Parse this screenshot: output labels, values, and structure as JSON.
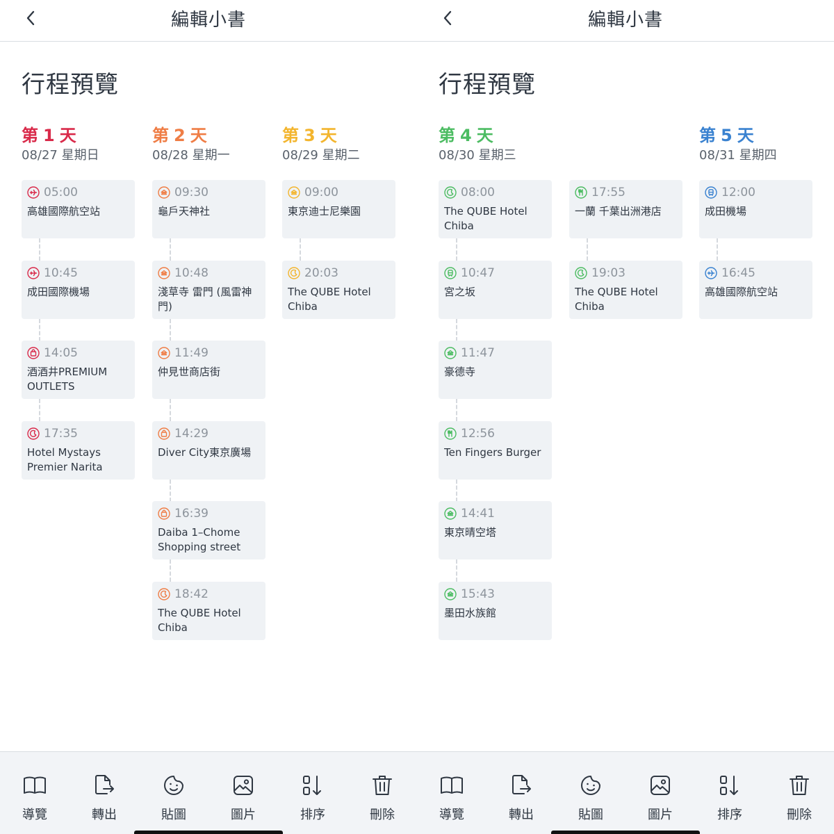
{
  "colors": {
    "text": "#2f3742",
    "muted": "#8d949c",
    "card_bg": "#eff2f5",
    "toolbar_bg": "#f2f4f7",
    "day1": "#d92a4a",
    "day2": "#ef7d45",
    "day3": "#f3b52e",
    "day4": "#4cbc62",
    "day5": "#3a82d0"
  },
  "screens": [
    {
      "header": {
        "title": "編輯小書"
      },
      "page_title": "行程預覽",
      "toolbar": [
        {
          "label": "導覽",
          "icon": "book-icon"
        },
        {
          "label": "轉出",
          "icon": "file-export-icon"
        },
        {
          "label": "貼圖",
          "icon": "sticker-icon"
        },
        {
          "label": "圖片",
          "icon": "image-icon"
        },
        {
          "label": "排序",
          "icon": "sort-icon"
        },
        {
          "label": "刪除",
          "icon": "trash-icon"
        }
      ]
    },
    {
      "header": {
        "title": "編輯小書"
      },
      "page_title": "行程預覽",
      "toolbar": [
        {
          "label": "導覽",
          "icon": "book-icon"
        },
        {
          "label": "轉出",
          "icon": "file-export-icon"
        },
        {
          "label": "貼圖",
          "icon": "sticker-icon"
        },
        {
          "label": "圖片",
          "icon": "image-icon"
        },
        {
          "label": "排序",
          "icon": "sort-icon"
        },
        {
          "label": "刪除",
          "icon": "trash-icon"
        }
      ]
    }
  ],
  "days": [
    {
      "prefix": "第",
      "number": "1",
      "suffix": "天",
      "date": "08/27 星期日",
      "color": "#d92a4a",
      "items": [
        {
          "time": "05:00",
          "name": "高雄國際航空站",
          "icon": "plane-icon"
        },
        {
          "time": "10:45",
          "name": "成田國際機場",
          "icon": "plane-icon"
        },
        {
          "time": "14:05",
          "name": "酒酒井PREMIUM OUTLETS",
          "icon": "shopping-bag-icon"
        },
        {
          "time": "17:35",
          "name": "Hotel Mystays Premier Narita",
          "icon": "moon-icon"
        }
      ]
    },
    {
      "prefix": "第",
      "number": "2",
      "suffix": "天",
      "date": "08/28 星期一",
      "color": "#ef7d45",
      "items": [
        {
          "time": "09:30",
          "name": "龜戶天神社",
          "icon": "attraction-icon"
        },
        {
          "time": "10:48",
          "name": "淺草寺 雷門 (風雷神門)",
          "icon": "attraction-icon"
        },
        {
          "time": "11:49",
          "name": "仲見世商店街",
          "icon": "attraction-icon"
        },
        {
          "time": "14:29",
          "name": "Diver City東京廣場",
          "icon": "shopping-bag-icon"
        },
        {
          "time": "16:39",
          "name": "Daiba 1–Chome Shopping street",
          "icon": "shopping-bag-icon"
        },
        {
          "time": "18:42",
          "name": "The QUBE Hotel Chiba",
          "icon": "moon-icon"
        }
      ]
    },
    {
      "prefix": "第",
      "number": "3",
      "suffix": "天",
      "date": "08/29 星期二",
      "color": "#f3b52e",
      "items": [
        {
          "time": "09:00",
          "name": "東京迪士尼樂園",
          "icon": "attraction-icon"
        },
        {
          "time": "20:03",
          "name": "The QUBE Hotel Chiba",
          "icon": "moon-icon"
        }
      ]
    },
    {
      "prefix": "第",
      "number": "4",
      "suffix": "天",
      "date": "08/30 星期三",
      "color": "#4cbc62",
      "items": [
        {
          "time": "08:00",
          "name": "The QUBE Hotel Chiba",
          "icon": "moon-icon"
        },
        {
          "time": "10:47",
          "name": "宮之坂",
          "icon": "train-icon"
        },
        {
          "time": "11:47",
          "name": "豪德寺",
          "icon": "attraction-icon"
        },
        {
          "time": "12:56",
          "name": "Ten Fingers Burger",
          "icon": "restaurant-icon"
        },
        {
          "time": "14:41",
          "name": "東京晴空塔",
          "icon": "attraction-icon"
        },
        {
          "time": "15:43",
          "name": "墨田水族館",
          "icon": "attraction-icon"
        }
      ],
      "items_b": [
        {
          "time": "17:55",
          "name": "一蘭 千葉出洲港店",
          "icon": "restaurant-icon"
        },
        {
          "time": "19:03",
          "name": "The QUBE Hotel Chiba",
          "icon": "moon-icon"
        }
      ]
    },
    {
      "prefix": "第",
      "number": "5",
      "suffix": "天",
      "date": "08/31 星期四",
      "color": "#3a82d0",
      "items": [
        {
          "time": "12:00",
          "name": "成田機場",
          "icon": "train-icon"
        },
        {
          "time": "16:45",
          "name": "高雄國際航空站",
          "icon": "plane-icon"
        }
      ]
    }
  ]
}
